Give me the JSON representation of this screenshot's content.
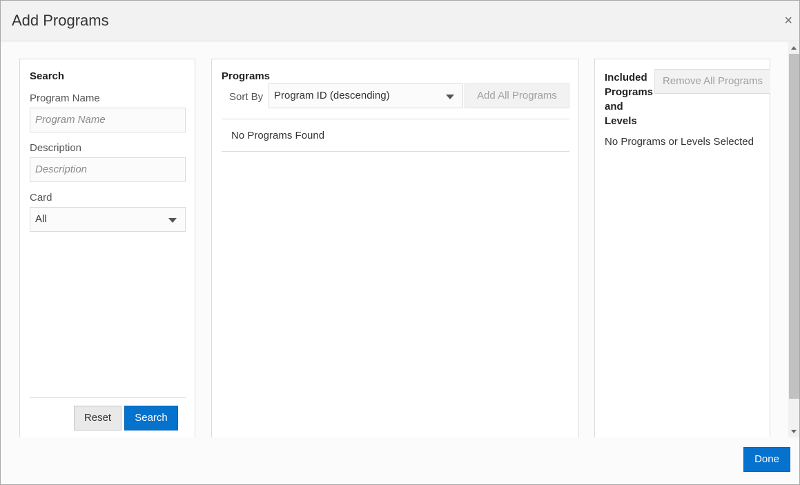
{
  "dialog": {
    "title": "Add Programs",
    "close_glyph": "×",
    "done_label": "Done"
  },
  "search": {
    "heading": "Search",
    "program_name_label": "Program Name",
    "program_name_value": "",
    "program_name_placeholder": "Program Name",
    "description_label": "Description",
    "description_value": "",
    "description_placeholder": "Description",
    "card_label": "Card",
    "card_selected": "All",
    "reset_label": "Reset",
    "search_label": "Search"
  },
  "programs": {
    "heading": "Programs",
    "sort_by_label": "Sort By",
    "sort_selected": "Program ID (descending)",
    "add_all_label": "Add All Programs",
    "empty_message": "No Programs Found"
  },
  "included": {
    "heading_line1": "Included",
    "heading_line2": "Programs",
    "heading_line3": "and",
    "heading_line4": "Levels",
    "remove_all_label": "Remove All Programs",
    "empty_message": "No Programs or Levels Selected"
  },
  "colors": {
    "primary": "#0572ce",
    "header_bg": "#f2f2f2",
    "border": "#dcdcdc"
  },
  "icons": {
    "close": "close-icon",
    "dropdown": "chevron-down-icon"
  }
}
